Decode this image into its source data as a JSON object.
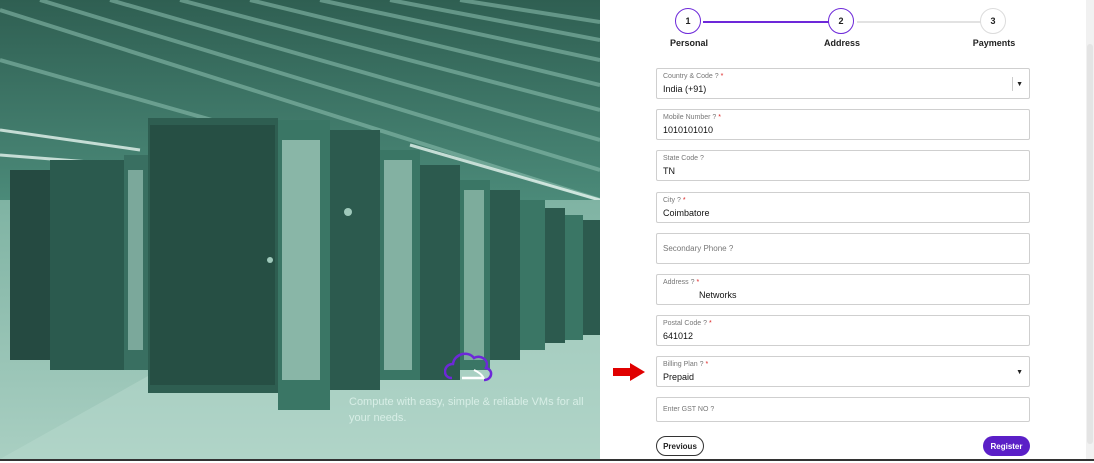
{
  "hero": {
    "caption": "Compute with easy, simple & reliable VMs for all your needs."
  },
  "stepper": {
    "steps": [
      {
        "number": "1",
        "label": "Personal"
      },
      {
        "number": "2",
        "label": "Address"
      },
      {
        "number": "3",
        "label": "Payments"
      }
    ],
    "active_color": "#6d28d9"
  },
  "form": {
    "country": {
      "label": "Country & Code",
      "value": "India (+91)"
    },
    "mobile": {
      "label": "Mobile Number",
      "value": "1010101010"
    },
    "state": {
      "label": "State Code",
      "value": "TN"
    },
    "city": {
      "label": "City",
      "value": "Coimbatore"
    },
    "secondary_phone": {
      "placeholder": "Secondary Phone"
    },
    "address": {
      "label": "Address",
      "value": "Networks"
    },
    "postal": {
      "label": "Postal Code",
      "value": "641012"
    },
    "billing": {
      "label": "Billing Plan",
      "value": "Prepaid"
    },
    "gst": {
      "placeholder": "Enter GST NO"
    },
    "help_icon": "?",
    "required_mark": "*"
  },
  "buttons": {
    "previous": "Previous",
    "register": "Register"
  },
  "colors": {
    "brand": "#5b1fc7",
    "annotation_arrow": "#e00000"
  }
}
